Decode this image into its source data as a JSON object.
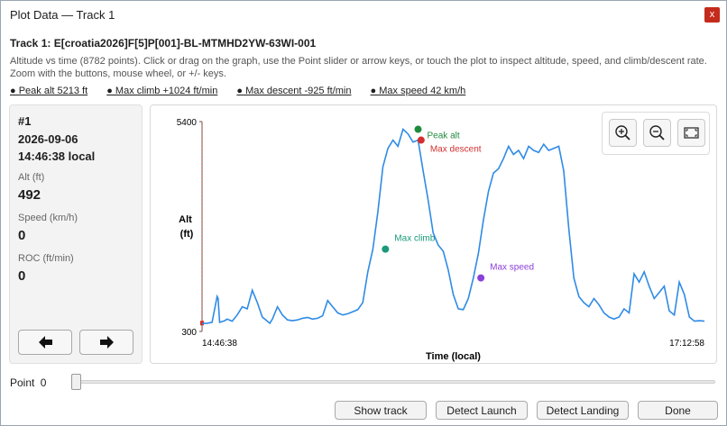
{
  "window": {
    "title": "Plot Data — Track 1",
    "close_glyph": "x"
  },
  "track": {
    "title": "Track 1: E[croatia2026]F[5]P[001]-BL-MTMHD2YW-63WI-001",
    "description": "Altitude vs time (8782 points). Click or drag on the graph, use the Point slider or arrow keys, or touch the plot to inspect altitude, speed, and climb/descent rate. Zoom with the buttons, mouse wheel, or +/- keys."
  },
  "links": {
    "peak_alt": "● Peak alt 5213 ft",
    "max_climb": "● Max climb +1024 ft/min",
    "max_descent": "● Max descent -925 ft/min",
    "max_speed": "● Max speed 42 km/h"
  },
  "info": {
    "index": "#1",
    "date": "2026-09-06",
    "time": "14:46:38 local",
    "alt_label": "Alt (ft)",
    "alt_value": "492",
    "speed_label": "Speed (km/h)",
    "speed_value": "0",
    "roc_label": "ROC (ft/min)",
    "roc_value": "0"
  },
  "point": {
    "label": "Point",
    "value": "0",
    "slider_fraction": 0
  },
  "buttons": {
    "show_track": "Show track",
    "detect_launch": "Detect Launch",
    "detect_landing": "Detect Landing",
    "done": "Done"
  },
  "icons": {
    "prev": "arrow-left-icon",
    "next": "arrow-right-icon",
    "zoom_in": "zoom-in-icon",
    "zoom_out": "zoom-out-icon",
    "fit": "fit-to-window-icon"
  },
  "colors": {
    "line": "#2f8be6",
    "peak": "#1f8a3c",
    "climb": "#1a9a7a",
    "descent": "#d32f2f",
    "speed": "#8a3fd9",
    "close": "#c42b1c"
  },
  "chart_data": {
    "type": "line",
    "xlabel": "Time (local)",
    "ylabel": "Alt (ft)",
    "x_tick_labels": [
      "14:46:38",
      "17:12:58"
    ],
    "y_tick_labels": [
      "300",
      "5400"
    ],
    "ylim": [
      300,
      5400
    ],
    "xlim": [
      0,
      100
    ],
    "series": [
      {
        "x": [
          0,
          1,
          2,
          3,
          3.2,
          3.5,
          4.5,
          5,
          6,
          7,
          8,
          9,
          10,
          11,
          12,
          13,
          13.5,
          14,
          15,
          16,
          17,
          18,
          19,
          20,
          21,
          22,
          23,
          24,
          25,
          26,
          27,
          28,
          29,
          30,
          31,
          32,
          33,
          34,
          35,
          36,
          37,
          38,
          39,
          40,
          41,
          42,
          43,
          44,
          45,
          46,
          47,
          48,
          49,
          50,
          51,
          52,
          53,
          54,
          55,
          56,
          57,
          58,
          59,
          60,
          61,
          62,
          63,
          64,
          65,
          66,
          67,
          68,
          69,
          70,
          71,
          72,
          73,
          74,
          75,
          76,
          77,
          78,
          79,
          80,
          81,
          82,
          83,
          84,
          85,
          86,
          87,
          88,
          89,
          90,
          91,
          92,
          93,
          94,
          95,
          96,
          97,
          98,
          99,
          100
        ],
        "y": [
          492,
          500,
          520,
          1150,
          1100,
          520,
          560,
          600,
          550,
          700,
          900,
          850,
          1300,
          1000,
          650,
          550,
          500,
          600,
          900,
          700,
          580,
          560,
          580,
          620,
          640,
          600,
          620,
          680,
          1050,
          900,
          750,
          700,
          730,
          780,
          830,
          1000,
          1750,
          2300,
          3200,
          4300,
          4750,
          4950,
          4800,
          5213,
          5100,
          4900,
          4950,
          4200,
          3500,
          2700,
          2400,
          2250,
          1800,
          1200,
          850,
          830,
          1100,
          1600,
          2200,
          3000,
          3700,
          4150,
          4250,
          4500,
          4800,
          4600,
          4700,
          4500,
          4800,
          4700,
          4650,
          4850,
          4700,
          4750,
          4800,
          4200,
          2800,
          1600,
          1150,
          1000,
          900,
          1100,
          950,
          750,
          650,
          600,
          650,
          850,
          750,
          1700,
          1500,
          1750,
          1400,
          1100,
          1250,
          1400,
          800,
          700,
          1500,
          1200,
          650,
          550,
          560,
          550
        ]
      }
    ],
    "markers": [
      {
        "name": "Peak alt",
        "x": 43,
        "y": 5213
      },
      {
        "name": "Max descent",
        "x": 43.6,
        "y": 4950
      },
      {
        "name": "Max climb",
        "x": 36.5,
        "y": 2300
      },
      {
        "name": "Max speed",
        "x": 55.5,
        "y": 1600
      }
    ],
    "grid": false
  }
}
